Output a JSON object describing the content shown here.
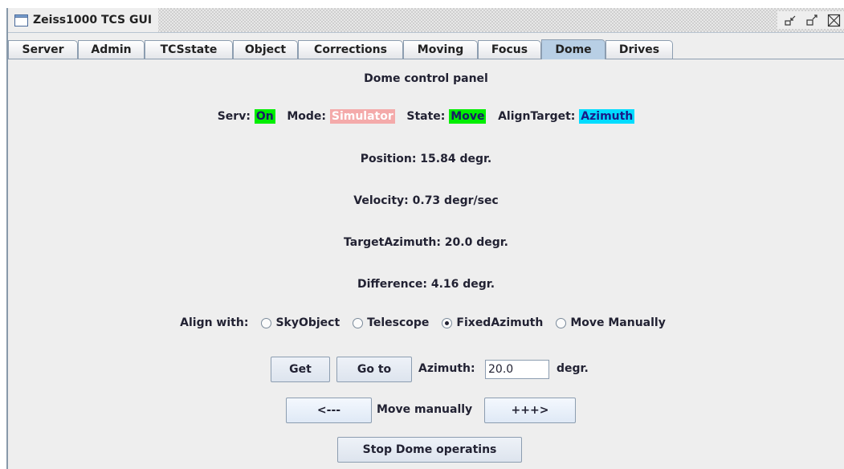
{
  "window": {
    "title": "Zeiss1000 TCS GUI"
  },
  "tabs": [
    {
      "label": "Server"
    },
    {
      "label": "Admin"
    },
    {
      "label": "TCSstate"
    },
    {
      "label": "Object"
    },
    {
      "label": "Corrections"
    },
    {
      "label": "Moving"
    },
    {
      "label": "Focus"
    },
    {
      "label": "Dome",
      "active": true
    },
    {
      "label": "Drives"
    }
  ],
  "panel": {
    "heading": "Dome control panel",
    "status": {
      "serv_label": "Serv:",
      "serv_value": "On",
      "mode_label": "Mode:",
      "mode_value": "Simulator",
      "state_label": "State:",
      "state_value": "Move",
      "align_label": "AlignTarget:",
      "align_value": "Azimuth"
    },
    "position": "Position: 15.84 degr.",
    "velocity": "Velocity: 0.73 degr/sec",
    "target_azimuth": "TargetAzimuth: 20.0 degr.",
    "difference": "Difference: 4.16 degr.",
    "align_with": {
      "label": "Align with:",
      "options": [
        {
          "label": "SkyObject",
          "selected": false
        },
        {
          "label": "Telescope",
          "selected": false
        },
        {
          "label": "FixedAzimuth",
          "selected": true
        },
        {
          "label": "Move Manually",
          "selected": false
        }
      ]
    },
    "get_button": "Get",
    "goto_button": "Go to",
    "azimuth_label": "Azimuth:",
    "azimuth_value": "20.0",
    "azimuth_unit": "degr.",
    "move_left_button": "<---",
    "move_manually_label": "Move manually",
    "move_right_button": "+++>",
    "stop_button": "Stop Dome operatins"
  },
  "colors": {
    "on": "#00ee00",
    "simulator": "#f4aaaa",
    "move": "#00ee00",
    "azimuth": "#00dcff",
    "active_tab": "#b8cfe5"
  }
}
